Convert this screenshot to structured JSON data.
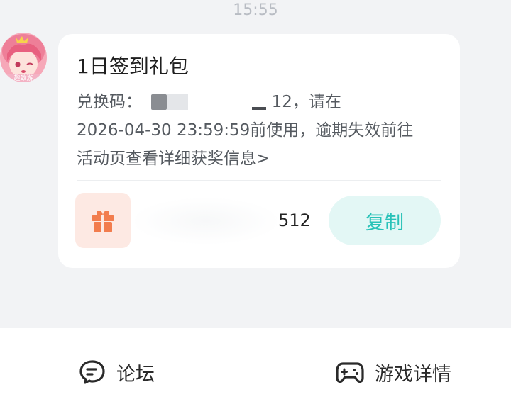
{
  "status": {
    "time": "15:55"
  },
  "message": {
    "avatar_icon": "anime-girl-avatar-icon",
    "title": "1日签到礼包",
    "body_prefix": "兑换码：",
    "body_code_tail": "12，请在",
    "body_line2": "2026-04-30 23:59:59前使用，逾期失效前往",
    "body_line3": "活动页查看详细获奖信息>"
  },
  "gift": {
    "icon": "gift-icon",
    "code_visible": "512",
    "copy_label": "复制"
  },
  "bottom_nav": {
    "forum": {
      "label": "论坛",
      "icon": "forum-chat-icon"
    },
    "game": {
      "label": "游戏详情",
      "icon": "gamepad-icon"
    }
  },
  "colors": {
    "page_bg": "#f2f3f5",
    "accent": "#28c2b8",
    "accent_bg": "#e3f7f5",
    "gift_orange": "#f27d4e",
    "gift_bg": "#fde9e3"
  }
}
